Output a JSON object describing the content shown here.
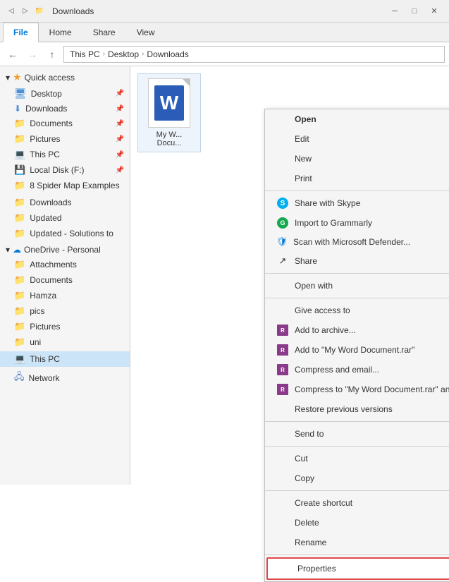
{
  "titleBar": {
    "title": "Downloads",
    "icons": [
      "back-icon",
      "forward-icon",
      "up-icon"
    ],
    "windowControls": [
      "minimize",
      "maximize",
      "close"
    ]
  },
  "ribbon": {
    "tabs": [
      "File",
      "Home",
      "Share",
      "View"
    ],
    "activeTab": "File"
  },
  "addressBar": {
    "backDisabled": false,
    "forwardDisabled": true,
    "path": [
      "This PC",
      "Desktop",
      "Downloads"
    ]
  },
  "sidebar": {
    "sections": [
      {
        "id": "quick-access",
        "label": "Quick access",
        "icon": "star-icon",
        "items": [
          {
            "label": "Desktop",
            "icon": "folder-icon",
            "pinned": true
          },
          {
            "label": "Downloads",
            "icon": "folder-arrow-icon",
            "pinned": true
          },
          {
            "label": "Documents",
            "icon": "folder-icon",
            "pinned": true
          },
          {
            "label": "Pictures",
            "icon": "folder-icon",
            "pinned": true
          },
          {
            "label": "This PC",
            "icon": "pc-icon",
            "pinned": true
          },
          {
            "label": "Local Disk (F:)",
            "icon": "drive-icon",
            "pinned": true
          },
          {
            "label": "8 Spider Map Examples",
            "icon": "folder-icon",
            "pinned": false
          }
        ]
      },
      {
        "id": "nav-folders",
        "items": [
          {
            "label": "Downloads",
            "icon": "folder-icon"
          },
          {
            "label": "Updated",
            "icon": "folder-icon"
          },
          {
            "label": "Updated - Solutions to",
            "icon": "folder-icon"
          }
        ]
      },
      {
        "id": "onedrive",
        "label": "OneDrive - Personal",
        "icon": "onedrive-icon",
        "items": [
          {
            "label": "Attachments",
            "icon": "folder-icon"
          },
          {
            "label": "Documents",
            "icon": "folder-icon"
          },
          {
            "label": "Hamza",
            "icon": "folder-icon"
          },
          {
            "label": "pics",
            "icon": "folder-icon"
          },
          {
            "label": "Pictures",
            "icon": "folder-icon"
          },
          {
            "label": "uni",
            "icon": "folder-icon"
          }
        ]
      },
      {
        "id": "this-pc",
        "label": "This PC",
        "icon": "pc-icon",
        "selected": true
      },
      {
        "id": "network",
        "label": "Network",
        "icon": "network-icon"
      }
    ]
  },
  "content": {
    "files": [
      {
        "name": "My W... Docu...",
        "fullName": "My Word Document.docx",
        "type": "word"
      }
    ]
  },
  "contextMenu": {
    "items": [
      {
        "id": "open",
        "label": "Open",
        "bold": true,
        "icon": null
      },
      {
        "id": "edit",
        "label": "Edit",
        "icon": null
      },
      {
        "id": "new",
        "label": "New",
        "icon": null
      },
      {
        "id": "print",
        "label": "Print",
        "icon": null
      },
      {
        "id": "divider1"
      },
      {
        "id": "share-skype",
        "label": "Share with Skype",
        "icon": "skype-icon"
      },
      {
        "id": "grammarly",
        "label": "Import to Grammarly",
        "icon": "grammarly-icon"
      },
      {
        "id": "defender",
        "label": "Scan with Microsoft Defender...",
        "icon": "defender-icon"
      },
      {
        "id": "share",
        "label": "Share",
        "icon": "share-icon"
      },
      {
        "id": "divider2"
      },
      {
        "id": "open-with",
        "label": "Open with",
        "icon": null,
        "hasArrow": true
      },
      {
        "id": "divider3"
      },
      {
        "id": "give-access",
        "label": "Give access to",
        "icon": null,
        "hasArrow": true
      },
      {
        "id": "add-archive",
        "label": "Add to archive...",
        "icon": "winrar-icon"
      },
      {
        "id": "add-myword-rar",
        "label": "Add to \"My Word Document.rar\"",
        "icon": "winrar-icon"
      },
      {
        "id": "compress-email",
        "label": "Compress and email...",
        "icon": "winrar-icon"
      },
      {
        "id": "compress-myword-email",
        "label": "Compress to \"My Word Document.rar\" and email",
        "icon": "winrar-icon"
      },
      {
        "id": "restore-versions",
        "label": "Restore previous versions",
        "icon": null
      },
      {
        "id": "divider4"
      },
      {
        "id": "send-to",
        "label": "Send to",
        "icon": null,
        "hasArrow": true
      },
      {
        "id": "divider5"
      },
      {
        "id": "cut",
        "label": "Cut",
        "icon": null
      },
      {
        "id": "copy",
        "label": "Copy",
        "icon": null
      },
      {
        "id": "divider6"
      },
      {
        "id": "create-shortcut",
        "label": "Create shortcut",
        "icon": null
      },
      {
        "id": "delete",
        "label": "Delete",
        "icon": null
      },
      {
        "id": "rename",
        "label": "Rename",
        "icon": null
      },
      {
        "id": "divider7"
      },
      {
        "id": "properties",
        "label": "Properties",
        "icon": null,
        "highlight": true
      }
    ]
  }
}
